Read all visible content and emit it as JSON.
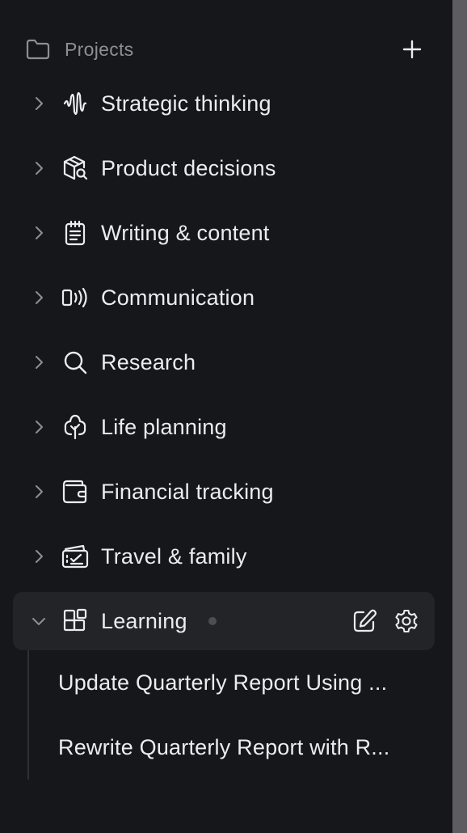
{
  "header": {
    "title": "Projects",
    "folder_icon": "folder-icon",
    "add_icon": "plus-icon"
  },
  "projects": [
    {
      "label": "Strategic thinking",
      "icon": "waveform-icon",
      "expanded": false
    },
    {
      "label": "Product decisions",
      "icon": "package-search-icon",
      "expanded": false
    },
    {
      "label": "Writing & content",
      "icon": "notepad-icon",
      "expanded": false
    },
    {
      "label": "Communication",
      "icon": "broadcast-icon",
      "expanded": false
    },
    {
      "label": "Research",
      "icon": "search-icon",
      "expanded": false
    },
    {
      "label": "Life planning",
      "icon": "tree-icon",
      "expanded": false
    },
    {
      "label": "Financial tracking",
      "icon": "wallet-icon",
      "expanded": false
    },
    {
      "label": "Travel & family",
      "icon": "ticket-icon",
      "expanded": false
    },
    {
      "label": "Learning",
      "icon": "blocks-icon",
      "expanded": true
    }
  ],
  "learning_children": [
    {
      "label": "Update Quarterly Report Using ..."
    },
    {
      "label": "Rewrite Quarterly Report with R..."
    }
  ],
  "colors": {
    "background": "#16171b",
    "active_row": "#232428",
    "text": "#ececef",
    "muted": "#8e8e94",
    "scrollbar": "#5c5c61"
  }
}
